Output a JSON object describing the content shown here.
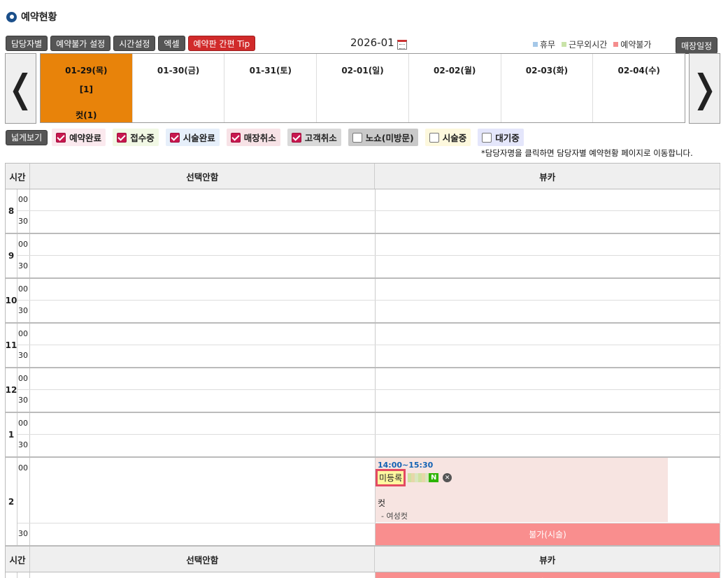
{
  "title": "예약현황",
  "toolbar": {
    "by_staff": "담당자별",
    "unavailable": "예약불가 설정",
    "time_setting": "시간설정",
    "excel": "엑셀",
    "tip": "예약판 간편 Tip"
  },
  "month": "2026-01",
  "legend": [
    {
      "label": "휴무",
      "color": "#a5c8e8"
    },
    {
      "label": "근무외시간",
      "color": "#c9e3a8"
    },
    {
      "label": "예약불가",
      "color": "#f48d8d"
    }
  ],
  "store_schedule": "매장일정",
  "days": [
    {
      "label": "01-29(목)",
      "count": "[1]",
      "service": "컷(1)"
    },
    {
      "label": "01-30(금)"
    },
    {
      "label": "01-31(토)"
    },
    {
      "label": "02-01(일)"
    },
    {
      "label": "02-02(월)"
    },
    {
      "label": "02-03(화)"
    },
    {
      "label": "02-04(수)"
    }
  ],
  "wide_view": "넓게보기",
  "filters": [
    {
      "label": "예약완료",
      "checked": true,
      "bg": "#fbe9ee"
    },
    {
      "label": "접수중",
      "checked": true,
      "bg": "#f1f8e4"
    },
    {
      "label": "시술완료",
      "checked": true,
      "bg": "#e6effa"
    },
    {
      "label": "매장취소",
      "checked": true,
      "bg": "#f7e2e6"
    },
    {
      "label": "고객취소",
      "checked": true,
      "bg": "#d9d9d9"
    },
    {
      "label": "노쇼(미방문)",
      "checked": false,
      "bg": "#c9c9c9"
    },
    {
      "label": "시술중",
      "checked": false,
      "bg": "#fdf8dd"
    },
    {
      "label": "대기중",
      "checked": false,
      "bg": "#e4e6fb"
    }
  ],
  "note": "*담당자명을 클릭하면 담당자별 예약현황 페이지로 이동합니다.",
  "grid": {
    "time_header": "시간",
    "col_a": "선택안함",
    "col_b": "뷰카",
    "hours": [
      "8",
      "9",
      "10",
      "11",
      "12",
      "1",
      "2"
    ],
    "min00": "00",
    "min30": "30",
    "blocked_label": "불가(시술)",
    "appointment": {
      "time": "14:00~15:30",
      "name": "미등록",
      "badge": "N",
      "close": "✕",
      "service": "컷",
      "sub": "- 여성컷"
    }
  }
}
